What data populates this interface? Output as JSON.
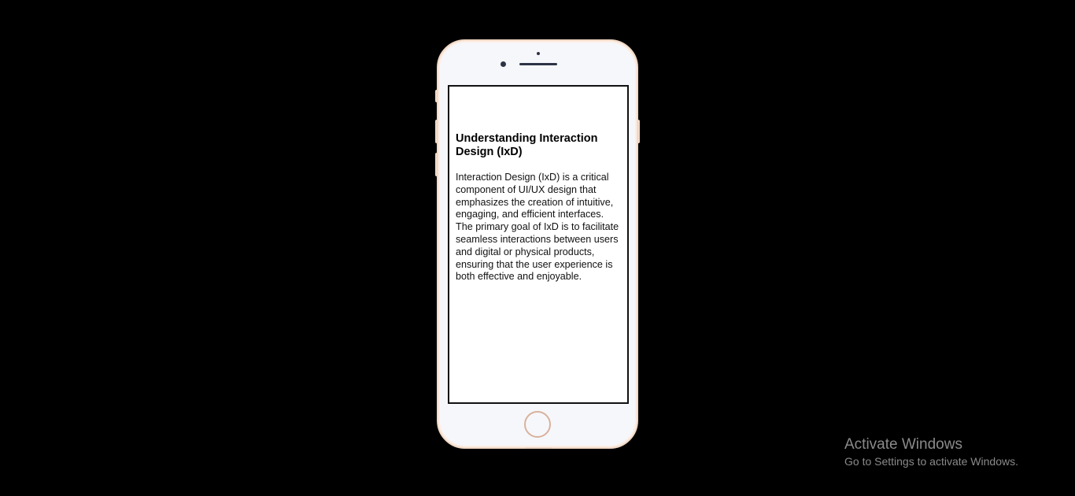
{
  "phone": {
    "content": {
      "title": "Understanding Interaction Design (IxD)",
      "body": "Interaction Design (IxD) is a critical component of UI/UX design that emphasizes the creation of intuitive, engaging, and efficient interfaces. The primary goal of IxD is to facilitate seamless interactions between users and digital or physical products, ensuring that the user experience is both effective and enjoyable."
    },
    "frame_color": "#f1d9c6",
    "screen_border_color": "#111111"
  },
  "watermark": {
    "title": "Activate Windows",
    "subtitle": "Go to Settings to activate Windows."
  }
}
